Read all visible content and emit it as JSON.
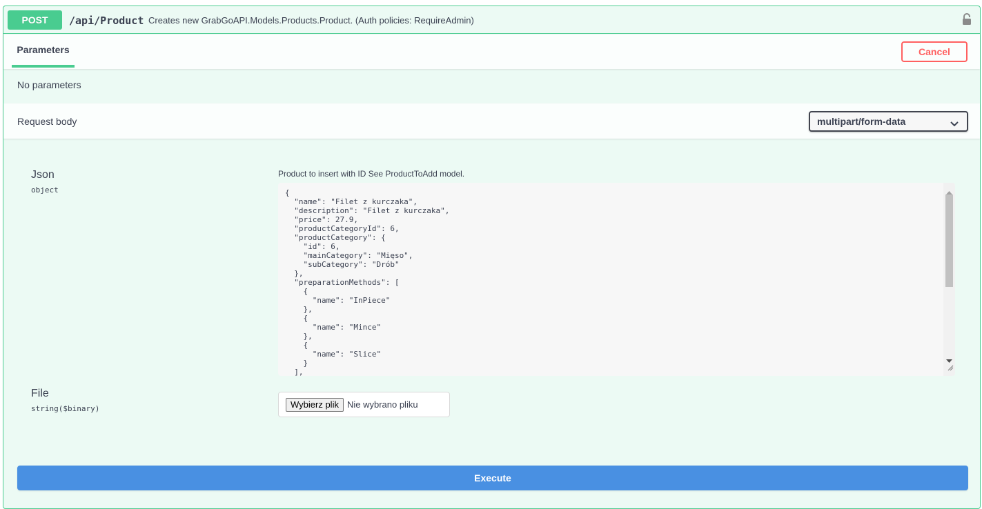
{
  "operation": {
    "method": "POST",
    "path": "/api/Product",
    "description": "Creates new GrabGoAPI.Models.Products.Product. (Auth policies: RequireAdmin)",
    "lock_icon": "lock-icon"
  },
  "parameters": {
    "tab_label": "Parameters",
    "cancel_label": "Cancel",
    "empty_text": "No parameters"
  },
  "request_body": {
    "title": "Request body",
    "content_type": "multipart/form-data",
    "fields": {
      "json": {
        "name": "Json",
        "type": "object",
        "description": "Product to insert with ID See ProductToAdd model.",
        "value": "{\n  \"name\": \"Filet z kurczaka\",\n  \"description\": \"Filet z kurczaka\",\n  \"price\": 27.9,\n  \"productCategoryId\": 6,\n  \"productCategory\": {\n    \"id\": 6,\n    \"mainCategory\": \"Mięso\",\n    \"subCategory\": \"Drób\"\n  },\n  \"preparationMethods\": [\n    {\n      \"name\": \"InPiece\"\n    },\n    {\n      \"name\": \"Mince\"\n    },\n    {\n      \"name\": \"Slice\"\n    }\n  ],"
      },
      "file": {
        "name": "File",
        "type": "string($binary)",
        "button_label": "Wybierz plik",
        "status": "Nie wybrano pliku"
      }
    }
  },
  "execute_label": "Execute",
  "colors": {
    "post_green": "#49cc90",
    "cancel_red": "#ff6060",
    "execute_blue": "#4990e2"
  }
}
